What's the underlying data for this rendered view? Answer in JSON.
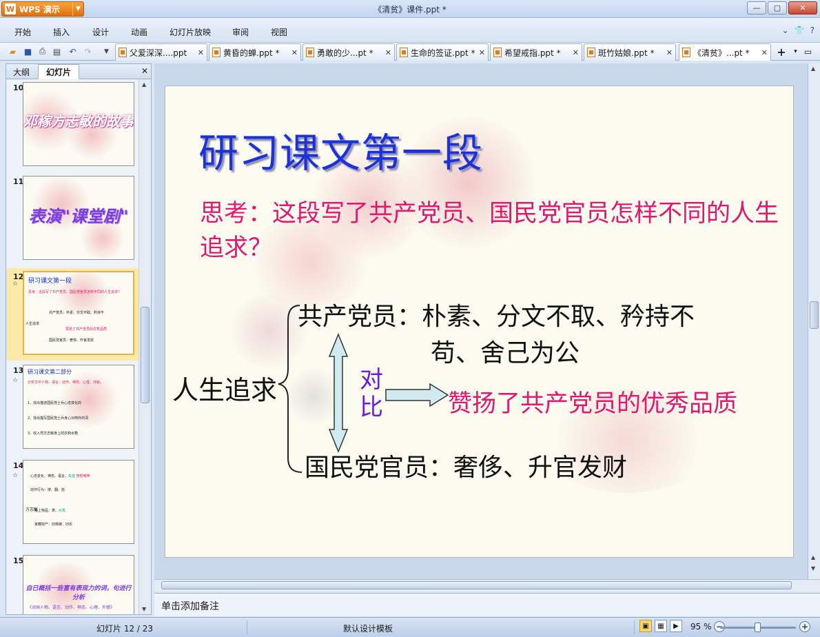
{
  "window": {
    "app_button": "WPS 演示",
    "title": "《清贫》课件.ppt *"
  },
  "menu": {
    "items": [
      "开始",
      "插入",
      "设计",
      "动画",
      "幻灯片放映",
      "审阅",
      "视图"
    ]
  },
  "doc_tabs": [
    {
      "label": "父爱深深....ppt"
    },
    {
      "label": "黄昏的蝉.ppt *"
    },
    {
      "label": "勇敢的少...pt *"
    },
    {
      "label": "生命的签证.ppt *"
    },
    {
      "label": "希望戒指.ppt *"
    },
    {
      "label": "斑竹姑娘.ppt *"
    },
    {
      "label": "《清贫》...pt *"
    }
  ],
  "left_panel": {
    "tabs": [
      "大纲",
      "幻灯片"
    ],
    "active_tab": "幻灯片",
    "thumbnails": [
      {
        "number": "10",
        "text": "邓稼方志敏的故事"
      },
      {
        "number": "11",
        "text": "表演\"课堂剧\""
      },
      {
        "number": "12",
        "text": "研习课文第一段",
        "selected": true
      },
      {
        "number": "13",
        "text": "研习课文第二部分"
      },
      {
        "number": "14",
        "text": "方志敏"
      },
      {
        "number": "15",
        "text": "自已概括一些富有表现力的词，句进行分析"
      }
    ],
    "thumb_details": {
      "t12_q": "思考：这段写了共产党员、国民党官员怎样不同的人生追求？",
      "t12_root": "人生追求",
      "t13_q": "分析文中人物、语言、动作、神态、心理、外貌。",
      "t15_sub": "《对国人物、语言、动作、神态、心理、外貌》"
    }
  },
  "slide": {
    "title": "研习课文第一段",
    "question": "思考：这段写了共产党员、国民党官员怎样不同的人生追求？",
    "root": "人生追求",
    "branch_top": "共产党员：朴素、分文不取、矜持不",
    "branch_top_cont": "苟、舍己为公",
    "branch_bottom": "国民党官员：奢侈、升官发财",
    "contrast": "对比",
    "conclusion": "赞扬了共产党员的优秀品质"
  },
  "notes": {
    "placeholder": "单击添加备注"
  },
  "status": {
    "slide_counter": "幻灯片 12 / 23",
    "template": "默认设计模板",
    "zoom": "95 %"
  },
  "colors": {
    "title_blue": "#1b33d6",
    "question_pink": "#e0186e",
    "contrast_purple": "#6a1fd6",
    "wps_orange": "#e1700f"
  },
  "icons": [
    "open-icon",
    "save-icon",
    "print-icon",
    "preview-icon",
    "undo-icon",
    "redo-icon",
    "help-icon",
    "shirt-icon"
  ]
}
